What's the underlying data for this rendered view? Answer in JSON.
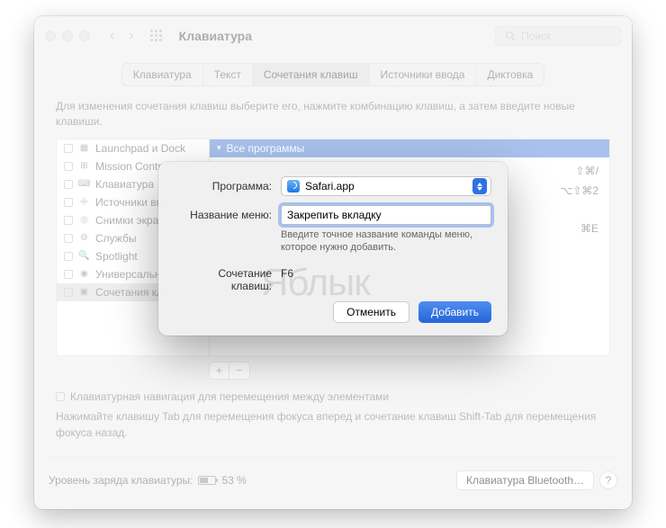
{
  "window": {
    "title": "Клавиатура",
    "search_placeholder": "Поиск"
  },
  "tabs": [
    "Клавиатура",
    "Текст",
    "Сочетания клавиш",
    "Источники ввода",
    "Диктовка"
  ],
  "active_tab_index": 2,
  "description": "Для изменения сочетания клавиш выберите его, нажмите комбинацию клавиш, а затем введите новые клавиши.",
  "sidebar": {
    "items": [
      {
        "label": "Launchpad и Dock"
      },
      {
        "label": "Mission Control"
      },
      {
        "label": "Клавиатура"
      },
      {
        "label": "Источники ввода"
      },
      {
        "label": "Снимки экрана"
      },
      {
        "label": "Службы"
      },
      {
        "label": "Spotlight"
      },
      {
        "label": "Универсальный д…"
      },
      {
        "label": "Сочетания клави…"
      }
    ],
    "selected_index": 8
  },
  "content": {
    "group_header": "Все программы",
    "shortcuts": [
      "⇧⌘/",
      "⌥⇧⌘2",
      "⌘E"
    ]
  },
  "bottom": {
    "checkbox_label": "Клавиатурная навигация для перемещения между элементами",
    "help_text": "Нажимайте клавишу Tab для перемещения фокуса вперед и сочетание клавиш Shift-Tab для перемещения фокуса назад."
  },
  "footer": {
    "battery_label": "Уровень заряда клавиатуры:",
    "battery_percent": "53 %",
    "bt_button": "Клавиатура Bluetooth…",
    "help": "?"
  },
  "sheet": {
    "app_label": "Программа:",
    "app_value": "Safari.app",
    "menu_label": "Название меню:",
    "menu_value": "Закрепить вкладку",
    "menu_hint": "Введите точное название команды меню, которое нужно добавить.",
    "shortcut_label": "Сочетание клавиш:",
    "shortcut_value": "F6",
    "cancel": "Отменить",
    "add": "Добавить"
  },
  "watermark": "Яблык"
}
